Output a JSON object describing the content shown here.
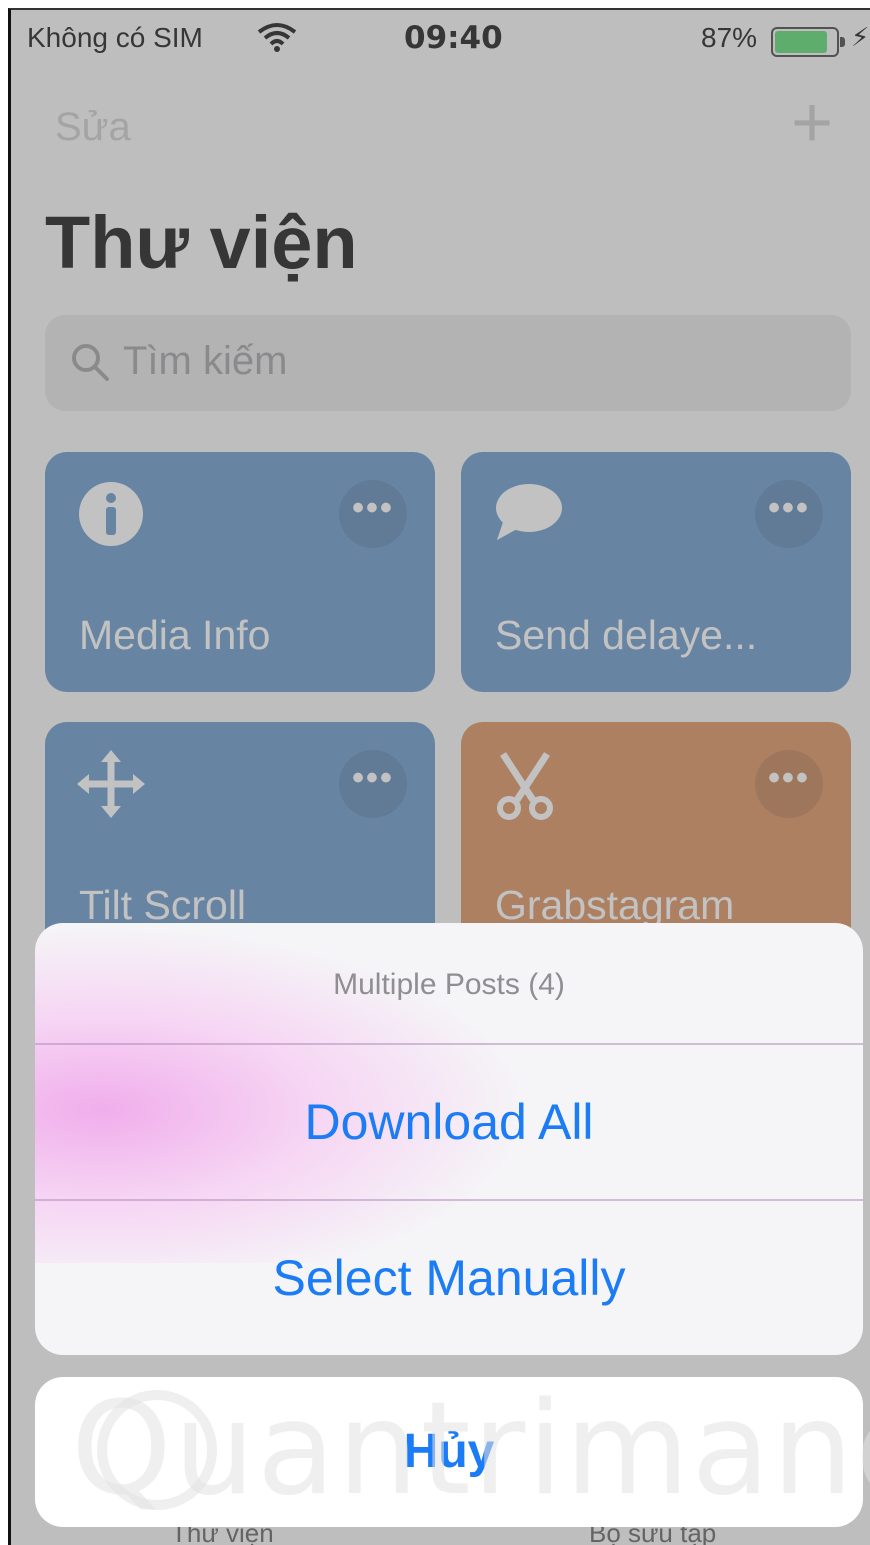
{
  "status_bar": {
    "carrier": "Không có SIM",
    "time": "09:40",
    "battery_percent": "87%",
    "battery_level": 0.87,
    "battery_color": "#4cd964"
  },
  "nav": {
    "edit_label": "Sửa",
    "add_icon": "plus-icon",
    "title": "Thư viện"
  },
  "search": {
    "placeholder": "Tìm kiếm",
    "icon": "search-icon"
  },
  "shortcuts": [
    {
      "label": "Media Info",
      "icon": "info-icon",
      "color": "#5a8fc7"
    },
    {
      "label": "Send delaye...",
      "icon": "speech-bubble-icon",
      "color": "#5a8fc7"
    },
    {
      "label": "Tilt Scroll",
      "icon": "move-arrows-icon",
      "color": "#5a8fc7"
    },
    {
      "label": "Grabstagram",
      "icon": "scissors-icon",
      "color": "#d9874f"
    }
  ],
  "action_sheet": {
    "title": "Multiple Posts (4)",
    "actions": [
      "Download All",
      "Select Manually"
    ],
    "cancel_label": "Hủy",
    "accent_color": "#1b7cf5"
  },
  "tab_bar": {
    "items": [
      "Thư viện",
      "Bộ sưu tập"
    ]
  },
  "watermark": {
    "text": "Quantrimang"
  }
}
